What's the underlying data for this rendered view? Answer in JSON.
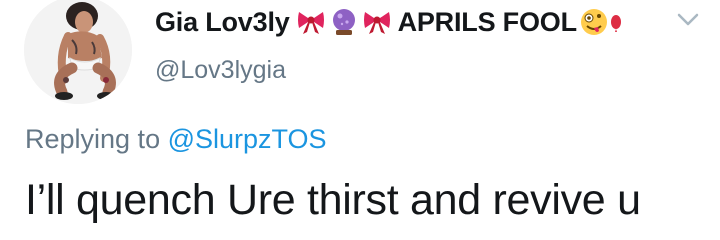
{
  "tweet": {
    "display_name": "Gia Lov3ly",
    "display_name_suffix": "APRILS FOOL",
    "handle": "@Lov3lygia",
    "replying_to_prefix": "Replying to",
    "replying_to_handle": "@SlurpzTOS",
    "text": "I’ll quench Ure thirst and revive u",
    "name_emoji_icons": [
      "ribbon-icon",
      "crystal-ball-icon",
      "ribbon-icon",
      "zany-face-icon",
      "balloon-icon"
    ]
  },
  "colors": {
    "text_primary": "#14171a",
    "text_secondary": "#657786",
    "link": "#1b95e0",
    "ribbon": "#e0245e",
    "crystal_ball": "#8e61c4",
    "zany_face": "#ffcc4d",
    "balloon": "#dd2e44"
  }
}
